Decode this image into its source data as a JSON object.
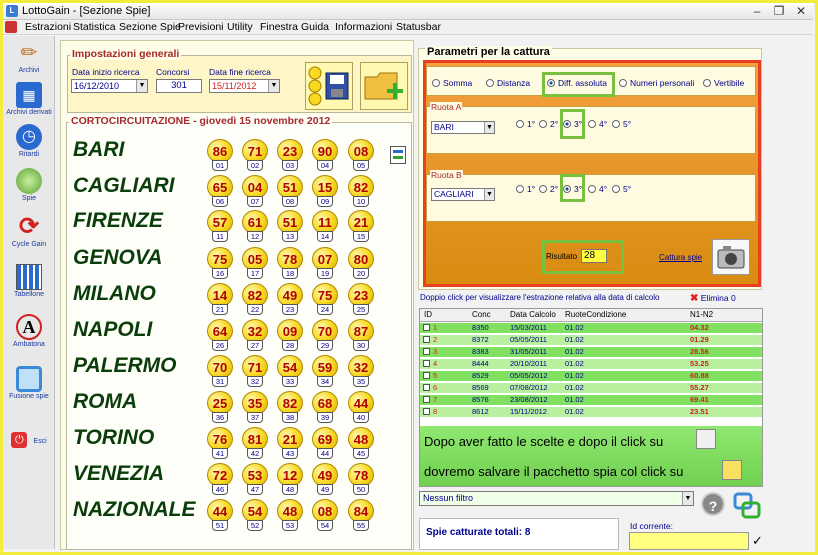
{
  "window": {
    "title": "LottoGain - [Sezione Spie]",
    "app_icon": "lottogain-app-icon",
    "controls": [
      "–",
      "❐",
      "✕"
    ]
  },
  "menu": [
    "Estrazioni",
    "Statistica",
    "Sezione Spie",
    "Previsioni",
    "Utility",
    "Finestra",
    "Guida",
    "Informazioni",
    "Statusbar"
  ],
  "sidebar": [
    {
      "label": "Archivi",
      "icon": "pencil-icon"
    },
    {
      "label": "Archivi derivati",
      "icon": "books-icon"
    },
    {
      "label": "Ritardi",
      "icon": "clock-icon"
    },
    {
      "label": "Spie",
      "icon": "spy-lamp-icon"
    },
    {
      "label": "Cycle Gain",
      "icon": "cycle-arrows-icon"
    },
    {
      "label": "Tabellone",
      "icon": "board-icon"
    },
    {
      "label": "Ambatona",
      "icon": "letter-a-icon"
    },
    {
      "label": "Fusione spie",
      "icon": "fusion-icon"
    },
    {
      "label": "Esci",
      "icon": "exit-icon"
    }
  ],
  "impostazioni": {
    "title": "Impostazioni generali",
    "inizio_label": "Data inizio ricerca",
    "inizio_value": "16/12/2010",
    "concorsi_label": "Concorsi",
    "concorsi_value": "301",
    "fine_label": "Data fine ricerca",
    "fine_value": "15/11/2012"
  },
  "cortocircuitazione": {
    "title": "CORTOCIRCUITAZIONE - giovedì 15 novembre 2012",
    "wheels": [
      {
        "name": "BARI",
        "numbers": [
          "86",
          "71",
          "23",
          "90",
          "08"
        ],
        "positions": [
          "01",
          "02",
          "03",
          "04",
          "05"
        ]
      },
      {
        "name": "CAGLIARI",
        "numbers": [
          "65",
          "04",
          "51",
          "15",
          "82"
        ],
        "positions": [
          "06",
          "07",
          "08",
          "09",
          "10"
        ]
      },
      {
        "name": "FIRENZE",
        "numbers": [
          "57",
          "61",
          "51",
          "11",
          "21"
        ],
        "positions": [
          "11",
          "12",
          "13",
          "14",
          "15"
        ]
      },
      {
        "name": "GENOVA",
        "numbers": [
          "75",
          "05",
          "78",
          "07",
          "80"
        ],
        "positions": [
          "16",
          "17",
          "18",
          "19",
          "20"
        ]
      },
      {
        "name": "MILANO",
        "numbers": [
          "14",
          "82",
          "49",
          "75",
          "23"
        ],
        "positions": [
          "21",
          "22",
          "23",
          "24",
          "25"
        ]
      },
      {
        "name": "NAPOLI",
        "numbers": [
          "64",
          "32",
          "09",
          "70",
          "87"
        ],
        "positions": [
          "26",
          "27",
          "28",
          "29",
          "30"
        ]
      },
      {
        "name": "PALERMO",
        "numbers": [
          "70",
          "71",
          "54",
          "59",
          "32"
        ],
        "positions": [
          "31",
          "32",
          "33",
          "34",
          "35"
        ]
      },
      {
        "name": "ROMA",
        "numbers": [
          "25",
          "35",
          "82",
          "68",
          "44"
        ],
        "positions": [
          "36",
          "37",
          "38",
          "39",
          "40"
        ]
      },
      {
        "name": "TORINO",
        "numbers": [
          "76",
          "81",
          "21",
          "69",
          "48"
        ],
        "positions": [
          "41",
          "42",
          "43",
          "44",
          "45"
        ]
      },
      {
        "name": "VENEZIA",
        "numbers": [
          "72",
          "53",
          "12",
          "49",
          "78"
        ],
        "positions": [
          "46",
          "47",
          "48",
          "49",
          "50"
        ]
      },
      {
        "name": "NAZIONALE",
        "numbers": [
          "44",
          "54",
          "48",
          "08",
          "84"
        ],
        "positions": [
          "51",
          "52",
          "53",
          "54",
          "55"
        ]
      }
    ]
  },
  "cattura": {
    "title": "Parametri per la cattura",
    "options": [
      {
        "label": "Somma",
        "selected": false
      },
      {
        "label": "Distanza",
        "selected": false
      },
      {
        "label": "Diff. assoluta",
        "selected": true
      },
      {
        "label": "Numeri personali",
        "selected": false
      },
      {
        "label": "Vertibile",
        "selected": false
      }
    ],
    "ruota_a": {
      "label": "Ruota A",
      "value": "BARI",
      "positions": [
        "1°",
        "2°",
        "3°",
        "4°",
        "5°"
      ],
      "selected_index": 2
    },
    "ruota_b": {
      "label": "Ruota B",
      "value": "CAGLIARI",
      "positions": [
        "1°",
        "2°",
        "3°",
        "4°",
        "5°"
      ],
      "selected_index": 2
    },
    "risultato_label": "Risultato",
    "risultato_value": "28",
    "cattura_link": "Cattura spie"
  },
  "list": {
    "hint": "Doppio click per visualizzare l'estrazione relativa alla data di calcolo",
    "elimina": "Elimina 0",
    "headers": [
      "ID",
      "Conc",
      "Data Calcolo",
      "RuoteCondizione",
      "N1-N2"
    ],
    "rows": [
      {
        "id": "1",
        "conc": "8350",
        "data": "15/03/2011",
        "ruote": "01.02",
        "n": "04.32"
      },
      {
        "id": "2",
        "conc": "8372",
        "data": "05/05/2011",
        "ruote": "01.02",
        "n": "01.29"
      },
      {
        "id": "3",
        "conc": "8383",
        "data": "31/05/2011",
        "ruote": "01.02",
        "n": "28.56"
      },
      {
        "id": "4",
        "conc": "8444",
        "data": "20/10/2011",
        "ruote": "01.02",
        "n": "53.25"
      },
      {
        "id": "5",
        "conc": "8529",
        "data": "05/05/2012",
        "ruote": "01.02",
        "n": "60.88"
      },
      {
        "id": "6",
        "conc": "8569",
        "data": "07/08/2012",
        "ruote": "01.02",
        "n": "55.27"
      },
      {
        "id": "7",
        "conc": "8576",
        "data": "23/08/2012",
        "ruote": "01.02",
        "n": "69.41"
      },
      {
        "id": "8",
        "conc": "8612",
        "data": "15/11/2012",
        "ruote": "01.02",
        "n": "23.51"
      }
    ],
    "annotation1": "Dopo aver fatto le scelte e dopo il click su",
    "annotation2": "dovremo salvare il pacchetto spia col click su"
  },
  "footer": {
    "filter_value": "Nessun filtro",
    "spie_text": "Spie catturate totali: 8",
    "id_corrente_label": "Id corrente:",
    "help": "?",
    "check": "✓"
  },
  "colors": {
    "accent_yellow": "#f3ec3c",
    "orange": "#e84020",
    "green_highlight": "#7ac040",
    "city_text": "#0a3d0a",
    "number_red": "#b00000"
  }
}
